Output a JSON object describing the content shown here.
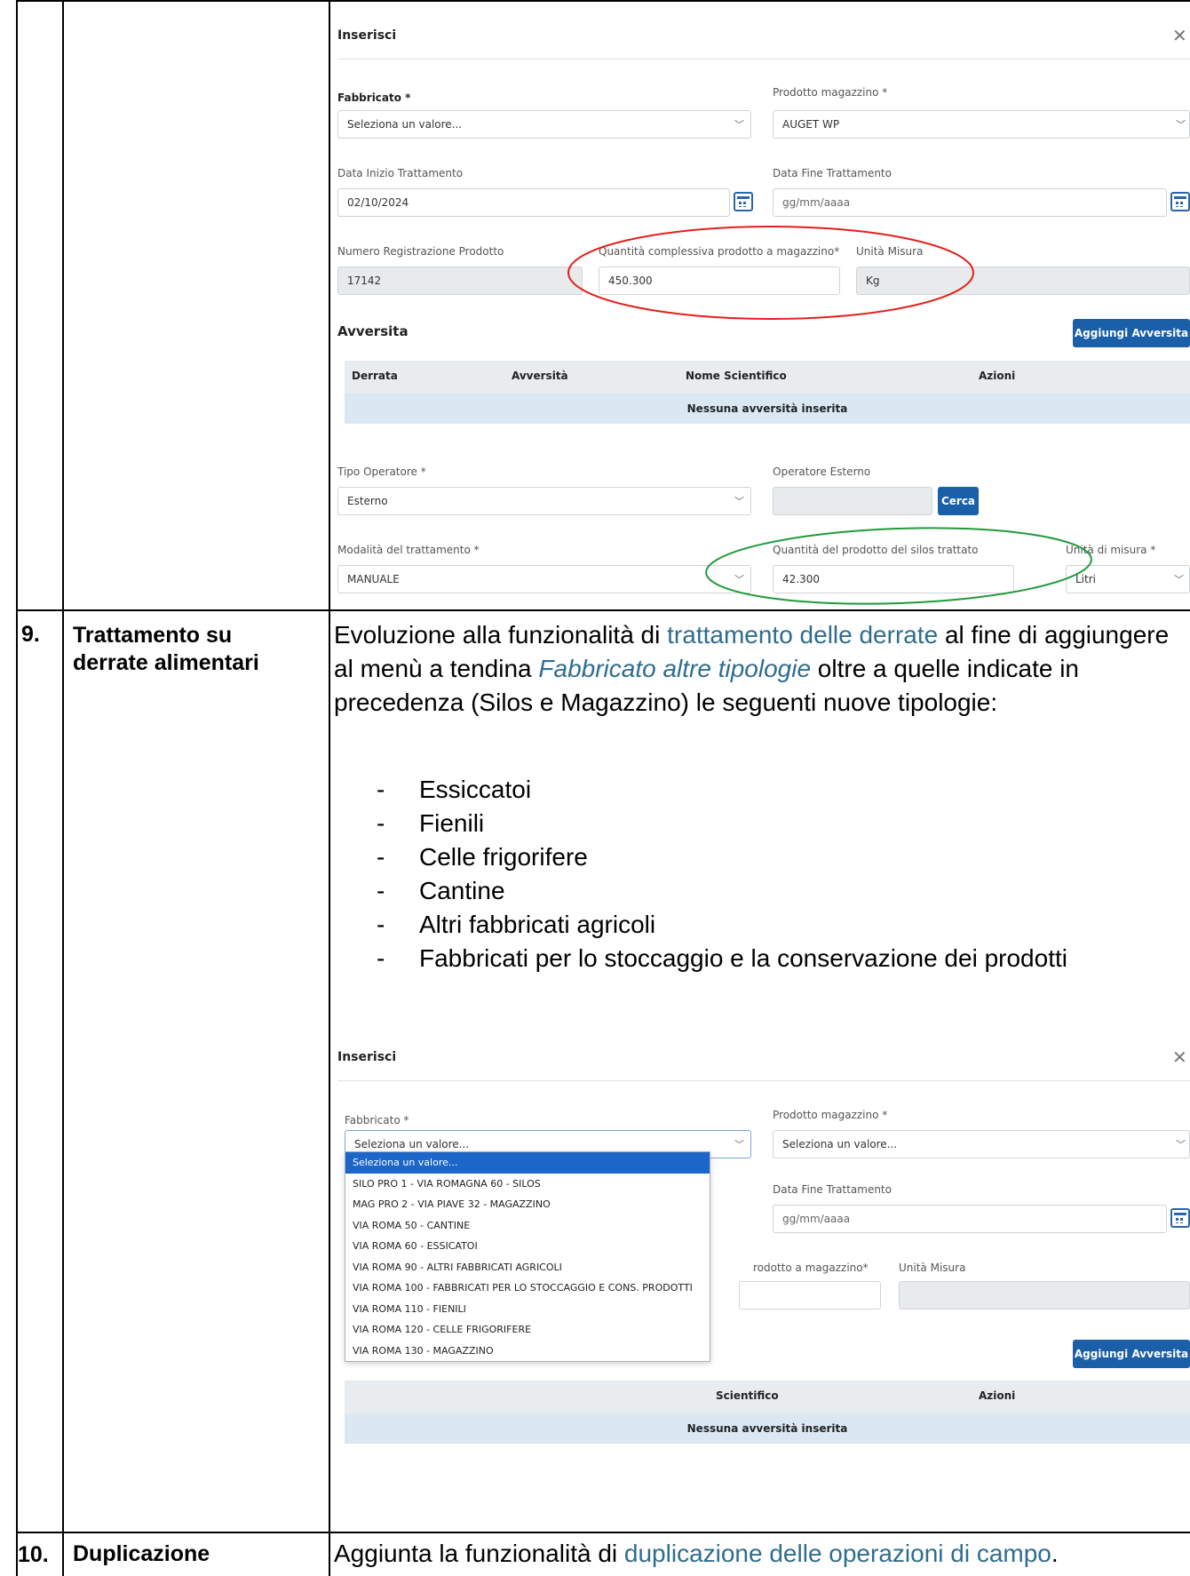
{
  "rows": [
    {
      "number": "9.",
      "topic_line1": "Trattamento su",
      "topic_line2": "derrate alimentari"
    },
    {
      "number": "10.",
      "topic": "Duplicazione",
      "description": [
        "Aggiunta la funzionalità di ",
        "duplicazione delle operazioni di campo",
        "."
      ]
    }
  ],
  "row9_text": {
    "p1": "Evoluzione alla funzionalità di ",
    "link1": "trattamento delle derrate",
    "p2": " al fine di aggiungere al menù a tendina ",
    "link2": "Fabbricato altre tipologie",
    "p3": " oltre a quelle indicate in precedenza (Silos e Magazzino) le seguenti nuove tipologie:",
    "bullets": [
      "Essiccatoi",
      "Fienili",
      "Celle frigorifere",
      "Cantine",
      "Altri fabbricati agricoli",
      "Fabbricati per lo stoccaggio e la conservazione dei prodotti"
    ]
  },
  "form1": {
    "title": "Inserisci",
    "fabbricato_label": "Fabbricato *",
    "fabbricato_value": "Seleziona un valore...",
    "prodotto_label": "Prodotto magazzino *",
    "prodotto_value": "AUGET WP",
    "data_inizio_label": "Data Inizio Trattamento",
    "data_inizio_value": "02/10/2024",
    "data_fine_label": "Data Fine Trattamento",
    "data_fine_value": "gg/mm/aaaa",
    "numero_reg_label": "Numero Registrazione Prodotto",
    "numero_reg_value": "17142",
    "quantita_label": "Quantità complessiva prodotto a magazzino*",
    "quantita_value": "450.300",
    "unita_label": "Unità Misura",
    "unita_value": "Kg",
    "avversita_title": "Avversita",
    "add_button": "Aggiungi Avversita",
    "table_headers": [
      "Derrata",
      "Avversità",
      "Nome Scientifico",
      "Azioni"
    ],
    "table_empty": "Nessuna avversità inserita",
    "tipo_operatore_label": "Tipo Operatore *",
    "tipo_operatore_value": "Esterno",
    "operatore_esterno_label": "Operatore Esterno",
    "operatore_esterno_value": "",
    "cerca_button": "Cerca",
    "modalita_label": "Modalità del trattamento *",
    "modalita_value": "MANUALE",
    "quantita_silos_label": "Quantità del prodotto del silos trattato",
    "quantita_silos_value": "42.300",
    "unita_misura_label": "Unità di misura *",
    "unita_misura_value": "Litri",
    "annotation_colors": {
      "red_ellipse": "#e3201b",
      "green_ellipse": "#1f9a3c"
    }
  },
  "form2": {
    "title": "Inserisci",
    "fabbricato_label": "Fabbricato *",
    "fabbricato_value": "Seleziona un valore...",
    "prodotto_label": "Prodotto magazzino *",
    "prodotto_value": "Seleziona un valore...",
    "data_fine_label": "Data Fine Trattamento",
    "data_fine_value": "gg/mm/aaaa",
    "quantita_label_partial": "rodotto a magazzino*",
    "unita_label": "Unità Misura",
    "add_button": "Aggiungi Avversita",
    "table_headers_visible": [
      "Scientifico",
      "Azioni"
    ],
    "table_empty": "Nessuna avversità inserita",
    "dropdown_options": [
      "Seleziona un valore...",
      "SILO PRO 1 - VIA ROMAGNA 60 - SILOS",
      "MAG PRO 2 - VIA PIAVE 32 - MAGAZZINO",
      "VIA ROMA 50 - CANTINE",
      "VIA ROMA 60 - ESSICATOI",
      "VIA ROMA 90 - ALTRI FABBRICATI AGRICOLI",
      "VIA ROMA 100 - FABBRICATI PER LO STOCCAGGIO E CONS. PRODOTTI",
      "VIA ROMA 110 - FIENILI",
      "VIA ROMA 120 - CELLE FRIGORIFERE",
      "VIA ROMA 130 - MAGAZZINO"
    ]
  }
}
